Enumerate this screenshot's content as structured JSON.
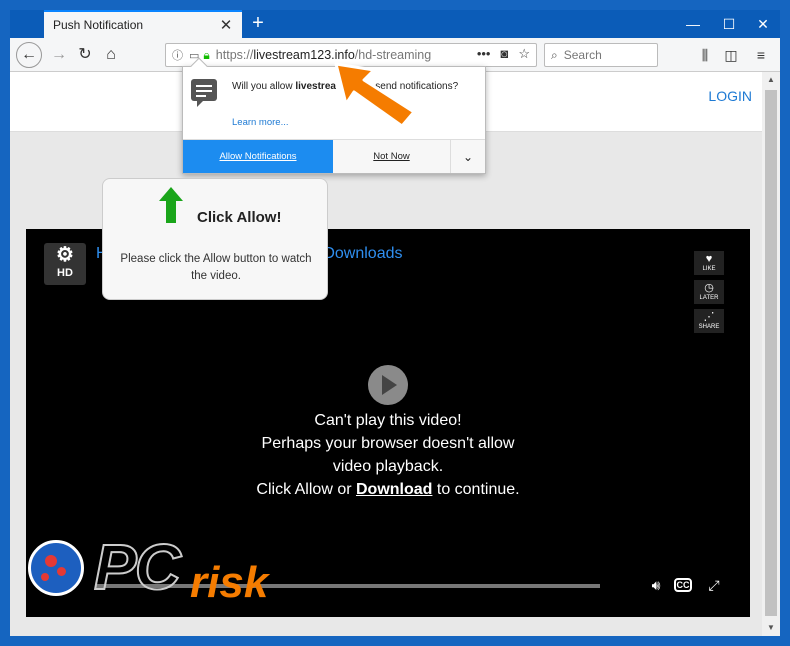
{
  "browser": {
    "tab_title": "Push Notification",
    "tab_close": "✕",
    "new_tab": "+",
    "window_controls": {
      "minimize": "—",
      "maximize": "☐",
      "close": "✕"
    },
    "url_scheme": "https://",
    "url_host": "livestream123.info",
    "url_path": "/hd-streaming",
    "url_more": "•••",
    "search_placeholder": "Search",
    "icons": [
      "back-icon",
      "forward-icon",
      "reload-icon",
      "home-icon",
      "info-icon",
      "notification-icon",
      "lock-icon",
      "pocket-icon",
      "star-icon",
      "search-icon",
      "library-icon",
      "sidebar-icon",
      "menu-icon"
    ]
  },
  "page": {
    "login_label": "LOGIN"
  },
  "notification_popup": {
    "text_prefix": "Will you allow ",
    "text_site": "livestrea",
    "text_site_tail": "fo",
    "text_suffix": " to send notifications?",
    "learn_more": "Learn more...",
    "allow_label": "Allow Notifications",
    "not_now_label": "Not Now",
    "more_icon": "⌄"
  },
  "click_allow": {
    "title": "Click Allow!",
    "description": "Please click the Allow button to watch the video."
  },
  "player": {
    "hd_label": "HD",
    "title_left": "H",
    "title_right": "d Downloads",
    "like_label": "LIKE",
    "later_label": "LATER",
    "share_label": "SHARE",
    "message_line1": "Can't play this video!",
    "message_line2": "Perhaps your browser doesn't allow",
    "message_line3": "video playback.",
    "message_line4_prefix": "Click Allow or ",
    "message_line4_link": "Download",
    "message_line4_suffix": " to continue.",
    "cc_label": "CC"
  },
  "watermark": {
    "pc": "PC",
    "risk": "risk"
  },
  "colors": {
    "accent": "#1c8cf0",
    "frame": "#1565c0",
    "orange": "#f57c00",
    "green": "#1aa51a"
  }
}
